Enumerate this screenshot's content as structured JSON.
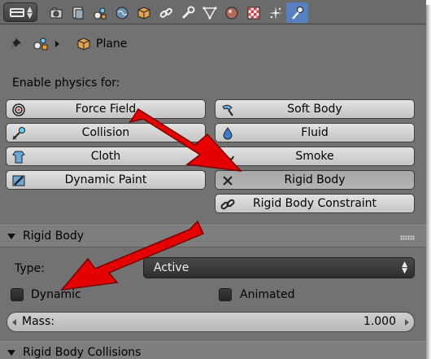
{
  "header": {
    "tabs": [
      {
        "icon": "render-icon"
      },
      {
        "icon": "render-layers-icon"
      },
      {
        "icon": "scene-icon"
      },
      {
        "icon": "world-icon"
      },
      {
        "icon": "object-icon"
      },
      {
        "icon": "constraints-icon"
      },
      {
        "icon": "modifiers-icon"
      },
      {
        "icon": "object-data-icon"
      },
      {
        "icon": "material-icon"
      },
      {
        "icon": "texture-icon"
      },
      {
        "icon": "particles-icon"
      },
      {
        "icon": "physics-icon"
      }
    ],
    "active_tab": "physics-icon",
    "accent_color": "#5680c2"
  },
  "breadcrumb": {
    "object_name": "Plane"
  },
  "physics": {
    "label": "Enable physics for:",
    "left_buttons": [
      {
        "label": "Force Field",
        "icon": "force-field-icon"
      },
      {
        "label": "Collision",
        "icon": "collision-icon"
      },
      {
        "label": "Cloth",
        "icon": "cloth-icon"
      },
      {
        "label": "Dynamic Paint",
        "icon": "dynamic-paint-icon"
      }
    ],
    "right_buttons": [
      {
        "label": "Soft Body",
        "icon": "soft-body-icon"
      },
      {
        "label": "Fluid",
        "icon": "fluid-icon"
      },
      {
        "label": "Smoke",
        "icon": "smoke-icon"
      },
      {
        "label": "Rigid Body",
        "icon": "close-x-icon"
      },
      {
        "label": "Rigid Body Constraint",
        "icon": "chain-icon"
      }
    ]
  },
  "rigid_body_panel": {
    "title": "Rigid Body",
    "type_label": "Type:",
    "type_value": "Active",
    "dynamic_label": "Dynamic",
    "dynamic_checked": false,
    "animated_label": "Animated",
    "animated_checked": false,
    "mass_label": "Mass:",
    "mass_value": "1.000"
  },
  "collisions_panel": {
    "title": "Rigid Body Collisions"
  },
  "annotation": {
    "arrow_color": "#e40000"
  }
}
